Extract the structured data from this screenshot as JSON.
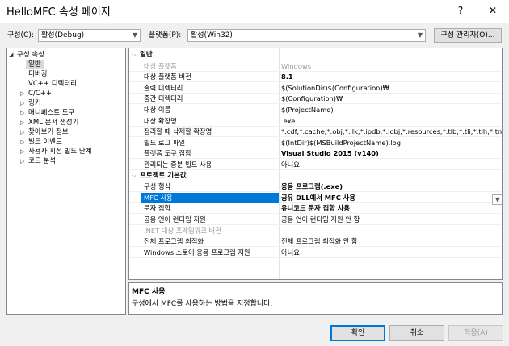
{
  "window": {
    "title": "HelloMFC 속성 페이지",
    "help": "?",
    "close": "✕"
  },
  "toolbar": {
    "config_label": "구성(C):",
    "config_value": "활성(Debug)",
    "platform_label": "플랫폼(P):",
    "platform_value": "활성(Win32)",
    "config_manager_label": "구성 관리자(O)..."
  },
  "tree": {
    "root": "구성 속성",
    "items": [
      {
        "label": "일반",
        "expandable": false,
        "selected": true
      },
      {
        "label": "디버깅",
        "expandable": false
      },
      {
        "label": "VC++ 디렉터리",
        "expandable": false
      },
      {
        "label": "C/C++",
        "expandable": true
      },
      {
        "label": "링커",
        "expandable": true
      },
      {
        "label": "매니페스트 도구",
        "expandable": true
      },
      {
        "label": "XML 문서 생성기",
        "expandable": true
      },
      {
        "label": "찾아보기 정보",
        "expandable": true
      },
      {
        "label": "빌드 이벤트",
        "expandable": true
      },
      {
        "label": "사용자 지정 빌드 단계",
        "expandable": true
      },
      {
        "label": "코드 분석",
        "expandable": true
      }
    ]
  },
  "grid": {
    "sections": [
      {
        "title": "일반",
        "rows": [
          {
            "name": "대상 플랫폼",
            "value": "Windows",
            "gray": true
          },
          {
            "name": "대상 플랫폼 버전",
            "value": "8.1",
            "bold": true
          },
          {
            "name": "출력 디렉터리",
            "value": "$(SolutionDir)$(Configuration)₩"
          },
          {
            "name": "중간 디렉터리",
            "value": "$(Configuration)₩"
          },
          {
            "name": "대상 이름",
            "value": "$(ProjectName)"
          },
          {
            "name": "대상 확장명",
            "value": ".exe"
          },
          {
            "name": "정리할 때 삭제할 확장명",
            "value": "*.cdf;*.cache;*.obj;*.ilk;*.ipdb;*.iobj;*.resources;*.tlb;*.tli;*.tlh;*.tmp;*.rsp"
          },
          {
            "name": "빌드 로그 파일",
            "value": "$(IntDir)$(MSBuildProjectName).log"
          },
          {
            "name": "플랫폼 도구 집합",
            "value": "Visual Studio 2015 (v140)",
            "bold": true
          },
          {
            "name": "관리되는 증분 빌드 사용",
            "value": "아니요"
          }
        ]
      },
      {
        "title": "프로젝트 기본값",
        "rows": [
          {
            "name": "구성 형식",
            "value": "응용 프로그램(.exe)",
            "bold": true
          },
          {
            "name": "MFC 사용",
            "value": "공유 DLL에서 MFC 사용",
            "bold": true,
            "selected": true
          },
          {
            "name": "문자 집합",
            "value": "유니코드 문자 집합 사용",
            "bold": true
          },
          {
            "name": "공용 언어 런타임 지원",
            "value": "공용 언어 런타임 지원 안 함"
          },
          {
            "name": ".NET 대상 프레임워크 버전",
            "value": "",
            "gray": true
          },
          {
            "name": "전체 프로그램 최적화",
            "value": "전체 프로그램 최적화 안 함"
          },
          {
            "name": "Windows 스토어 응용 프로그램 지원",
            "value": "아니요"
          }
        ]
      }
    ]
  },
  "description": {
    "title": "MFC 사용",
    "text": "구성에서 MFC를 사용하는 방법을 지정합니다."
  },
  "buttons": {
    "ok": "확인",
    "cancel": "취소",
    "apply": "적용(A)"
  },
  "colors": {
    "selection": "#0078d7",
    "ok_border": "#0078d7",
    "disabled_text": "#a0a0a0"
  }
}
